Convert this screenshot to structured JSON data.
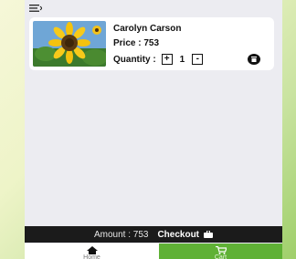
{
  "header": {
    "menu_icon": "menu-icon"
  },
  "cart": {
    "items": [
      {
        "name": "Carolyn Carson",
        "price_text": "Price : 753",
        "quantity_label": "Quantity :",
        "increment_label": "+",
        "quantity": "1",
        "decrement_label": "-",
        "image_icon": "sunflower-image",
        "remove_icon": "trash-icon"
      }
    ]
  },
  "footer": {
    "amount_text": "Amount : 753",
    "checkout_label": "Checkout",
    "checkout_icon": "bag-icon"
  },
  "bottom_nav": {
    "items": [
      {
        "label": "Home",
        "icon": "home-icon",
        "active": false
      },
      {
        "label": "Cart",
        "icon": "cart-icon",
        "active": true
      }
    ]
  },
  "colors": {
    "accent_green": "#5fb135",
    "bar_dark": "#1b1b1b",
    "screen_bg": "#ececf1"
  }
}
